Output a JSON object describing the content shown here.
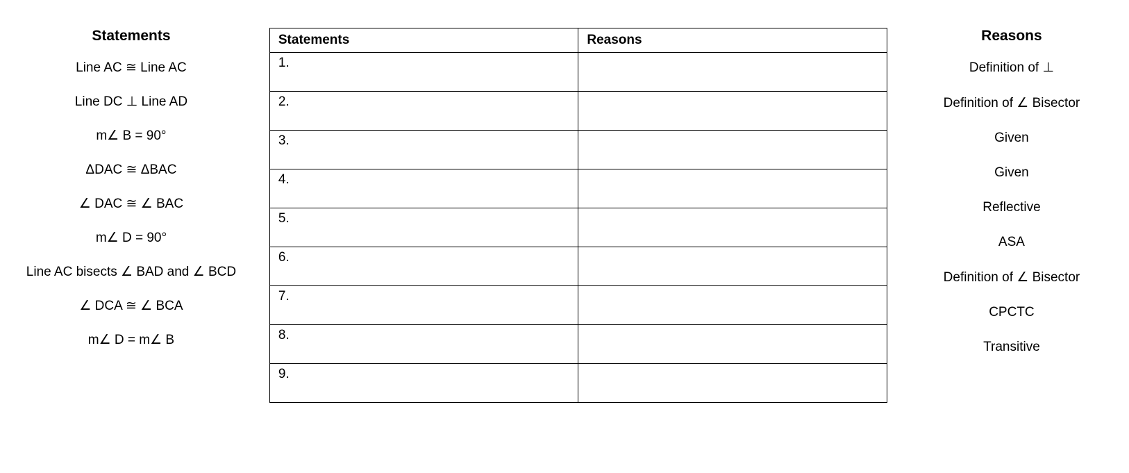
{
  "left": {
    "heading": "Statements",
    "items": [
      "Line AC ≅ Line AC",
      "Line DC ⊥ Line AD",
      "m∠ B = 90°",
      "ΔDAC ≅ ΔBAC",
      "∠ DAC ≅ ∠ BAC",
      "m∠ D = 90°",
      "Line AC bisects ∠ BAD and ∠ BCD",
      "∠ DCA ≅ ∠ BCA",
      "m∠ D = m∠ B"
    ]
  },
  "table": {
    "header_statements": "Statements",
    "header_reasons": "Reasons",
    "rows": [
      {
        "num": "1.",
        "stmt": "",
        "reason": ""
      },
      {
        "num": "2.",
        "stmt": "",
        "reason": ""
      },
      {
        "num": "3.",
        "stmt": "",
        "reason": ""
      },
      {
        "num": "4.",
        "stmt": "",
        "reason": ""
      },
      {
        "num": "5.",
        "stmt": "",
        "reason": ""
      },
      {
        "num": "6.",
        "stmt": "",
        "reason": ""
      },
      {
        "num": "7.",
        "stmt": "",
        "reason": ""
      },
      {
        "num": "8.",
        "stmt": "",
        "reason": ""
      },
      {
        "num": "9.",
        "stmt": "",
        "reason": ""
      }
    ]
  },
  "right": {
    "heading": "Reasons",
    "items": [
      "Definition of ⊥",
      "Definition of ∠ Bisector",
      "Given",
      "Given",
      "Reflective",
      "ASA",
      "Definition of ∠ Bisector",
      "CPCTC",
      "Transitive"
    ]
  }
}
